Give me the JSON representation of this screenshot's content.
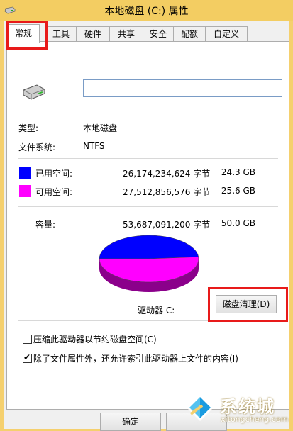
{
  "window": {
    "title": "本地磁盘 (C:) 属性"
  },
  "tabs": [
    "常规",
    "工具",
    "硬件",
    "共享",
    "安全",
    "配额",
    "自定义"
  ],
  "general": {
    "volume_name": "",
    "type_label": "类型:",
    "type_value": "本地磁盘",
    "fs_label": "文件系统:",
    "fs_value": "NTFS",
    "used_label": "已用空间:",
    "used_bytes": "26,174,234,624 字节",
    "used_gb": "24.3 GB",
    "free_label": "可用空间:",
    "free_bytes": "27,512,856,576 字节",
    "free_gb": "25.6 GB",
    "capacity_label": "容量:",
    "capacity_bytes": "53,687,091,200 字节",
    "capacity_gb": "50.0 GB",
    "drive_label": "驱动器 C:",
    "cleanup_button": "磁盘清理(D)",
    "compress_label": "压缩此驱动器以节约磁盘空间(C)",
    "index_label": "除了文件属性外，还允许索引此驱动器上文件的内容(I)",
    "compress_checked": false,
    "index_checked": true
  },
  "buttons": {
    "ok": "确定"
  },
  "colors": {
    "used": "#0000ff",
    "free": "#ff00ff",
    "highlight": "#e81a1a"
  },
  "chart_data": {
    "type": "pie",
    "categories": [
      "已用空间",
      "可用空间"
    ],
    "values": [
      26174234624,
      27512856576
    ]
  },
  "watermark": {
    "brand": "系统城",
    "url": "xitongcheng.com"
  }
}
